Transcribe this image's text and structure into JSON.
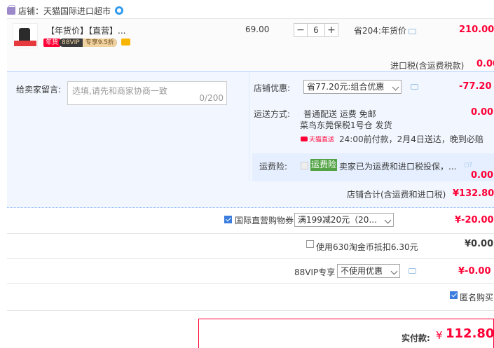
{
  "shop": {
    "label": "店铺：",
    "name": "天猫国际进口超市"
  },
  "item": {
    "title": "【年货价】【直营】...",
    "tag_nian": "年货",
    "tag_vip": "88VIP",
    "tag_vip_rate": "专享9.5折",
    "unit_price": "69.00",
    "quantity": "6",
    "qty_minus": "−",
    "qty_plus": "+",
    "promo_text": "省204:年货价",
    "line_total": "210.00",
    "import_tax_label": "进口税(含运费税款)",
    "import_tax_value": "0.00"
  },
  "message": {
    "label": "给卖家留言:",
    "placeholder": "选填,请先和商家协商一致",
    "counter": "0/200"
  },
  "shop_discount": {
    "label": "店铺优惠:",
    "selected": "省77.20元:组合优惠",
    "value": "-77.20"
  },
  "shipping": {
    "label": "运送方式:",
    "method": "普通配送 运费 免邮",
    "value": "0.00",
    "warehouse": "菜鸟东莞保税1号仓  发货",
    "tmall_tag": "天猫直送",
    "delivery_note": "24:00前付款，2月4日送达，晚到必赔"
  },
  "insurance": {
    "label": "运费险:",
    "tag": "运费险",
    "text": "卖家已为运费和进口税投保，...",
    "icons": "◻?",
    "value": "0.00"
  },
  "shop_total": {
    "label": "店铺合计(含运费和进口税)",
    "value": "¥132.80"
  },
  "coupon": {
    "label": "国际直营购物券",
    "selected": "满199减20元（20...",
    "value": "¥-20.00",
    "checked": true
  },
  "taojinbi": {
    "label": "使用630淘金币抵扣6.30元",
    "value": "¥0.00",
    "checked": false
  },
  "vip88": {
    "label": "88VIP专享",
    "selected": "不使用优惠",
    "value": "¥-0.00"
  },
  "anonymous": {
    "label": "匿名购买",
    "checked": true
  },
  "payment": {
    "label": "实付款:",
    "currency": "¥",
    "value": "112.80"
  },
  "colors": {
    "accent_red": "#ff0036",
    "blue_check": "#3a7ddd",
    "insurance_green": "#53a346"
  }
}
